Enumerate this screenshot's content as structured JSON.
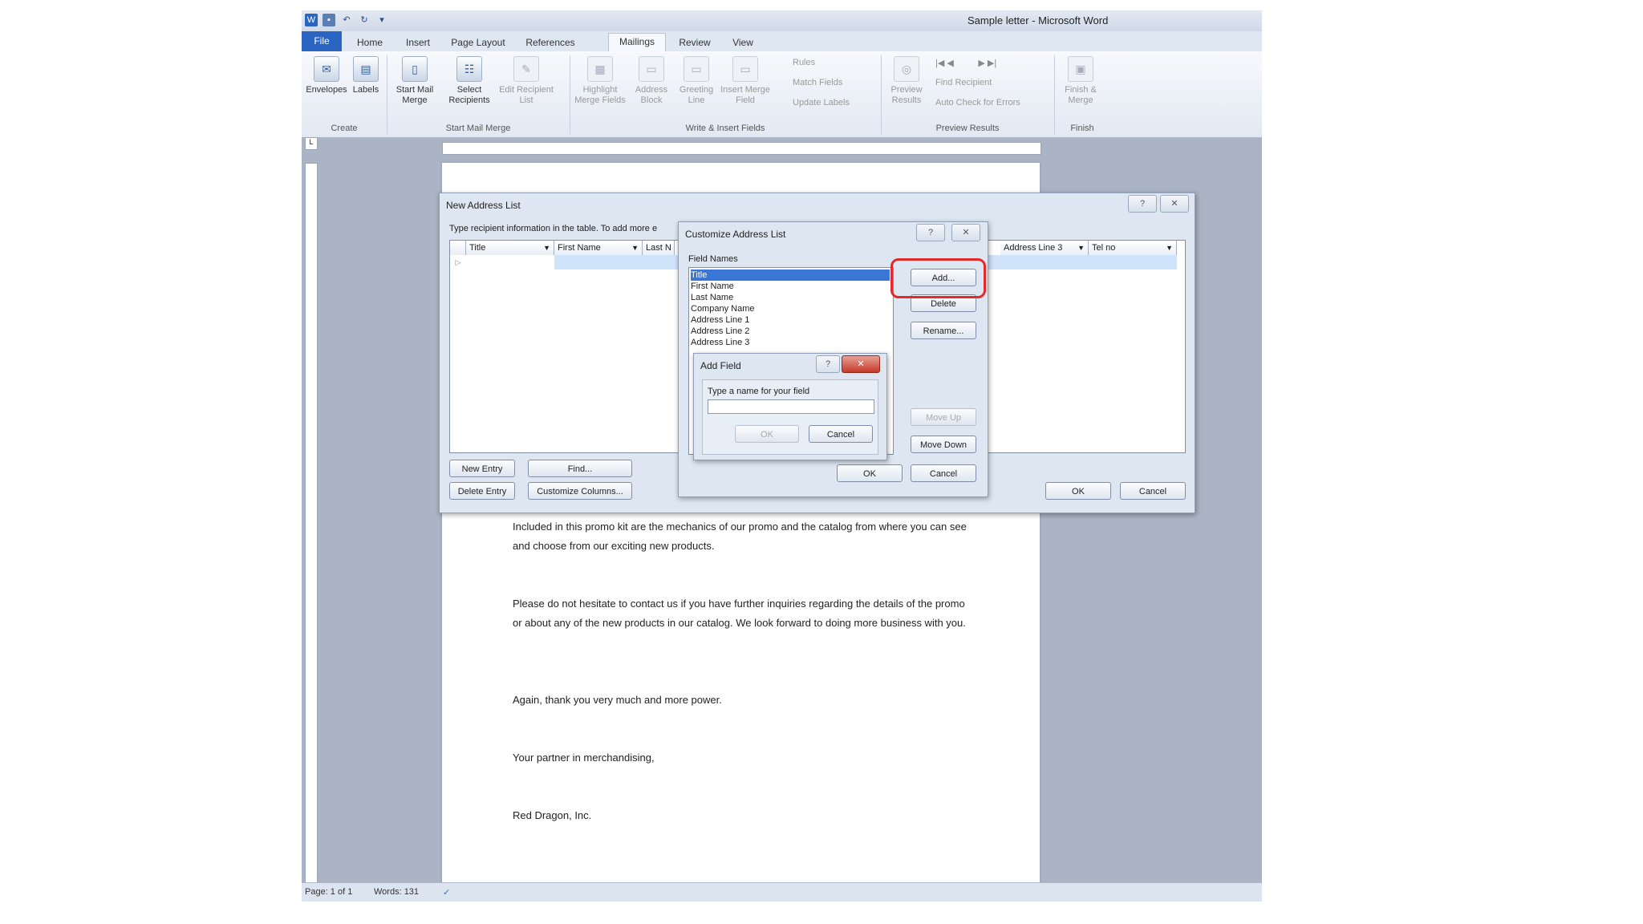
{
  "window": {
    "title": "Sample letter - Microsoft Word"
  },
  "tabs": [
    "File",
    "Home",
    "Insert",
    "Page Layout",
    "References",
    "Mailings",
    "Review",
    "View"
  ],
  "ribbon": {
    "envelopes": "Envelopes",
    "labels": "Labels",
    "start_mail_merge": "Start Mail Merge",
    "select_recipients": "Select Recipients",
    "edit_recipient_list": "Edit Recipient List",
    "highlight_merge_fields": "Highlight Merge Fields",
    "address_block": "Address Block",
    "greeting_line": "Greeting Line",
    "insert_merge_field": "Insert Merge Field",
    "rules": "Rules",
    "match_fields": "Match Fields",
    "update_labels": "Update Labels",
    "preview_results": "Preview Results",
    "find_recipient": "Find Recipient",
    "auto_check": "Auto Check for Errors",
    "finish_merge": "Finish & Merge",
    "group_create": "Create",
    "group_start": "Start Mail Merge",
    "group_write": "Write & Insert Fields",
    "group_preview": "Preview Results",
    "group_finish": "Finish"
  },
  "document": {
    "paragraphs": [
      "Included in this promo kit are the mechanics of our promo and the catalog from where you can see and choose from our exciting new products.",
      "Please do not hesitate to contact us if you have further inquiries regarding the details of the promo or about any of the new products in our catalog. We look forward to doing more business with you.",
      "Again, thank you very much and more power.",
      "Your partner in merchandising,",
      "Red Dragon, Inc."
    ]
  },
  "status": {
    "page": "Page: 1 of 1",
    "words": "Words: 131"
  },
  "new_address_list": {
    "title": "New Address List",
    "instruction": "Type recipient information in the table. To add more e",
    "columns": [
      "Title",
      "First Name",
      "Last N",
      "Address Line 3",
      "Tel no"
    ],
    "new_entry": "New Entry",
    "find": "Find...",
    "delete_entry": "Delete Entry",
    "customize_columns": "Customize Columns...",
    "ok": "OK",
    "cancel": "Cancel"
  },
  "customize_address_list": {
    "title": "Customize Address List",
    "field_names_label": "Field Names",
    "fields": [
      "Title",
      "First Name",
      "Last Name",
      "Company Name",
      "Address Line 1",
      "Address Line 2",
      "Address Line 3"
    ],
    "add": "Add...",
    "delete": "Delete",
    "rename": "Rename...",
    "move_up": "Move Up",
    "move_down": "Move Down",
    "ok": "OK",
    "cancel": "Cancel"
  },
  "add_field": {
    "title": "Add Field",
    "prompt": "Type a name for your field",
    "value": "",
    "ok": "OK",
    "cancel": "Cancel"
  },
  "colors": {
    "highlight": "#e22a2a",
    "file_tab": "#2a65c2",
    "selection": "#3a76d6"
  }
}
